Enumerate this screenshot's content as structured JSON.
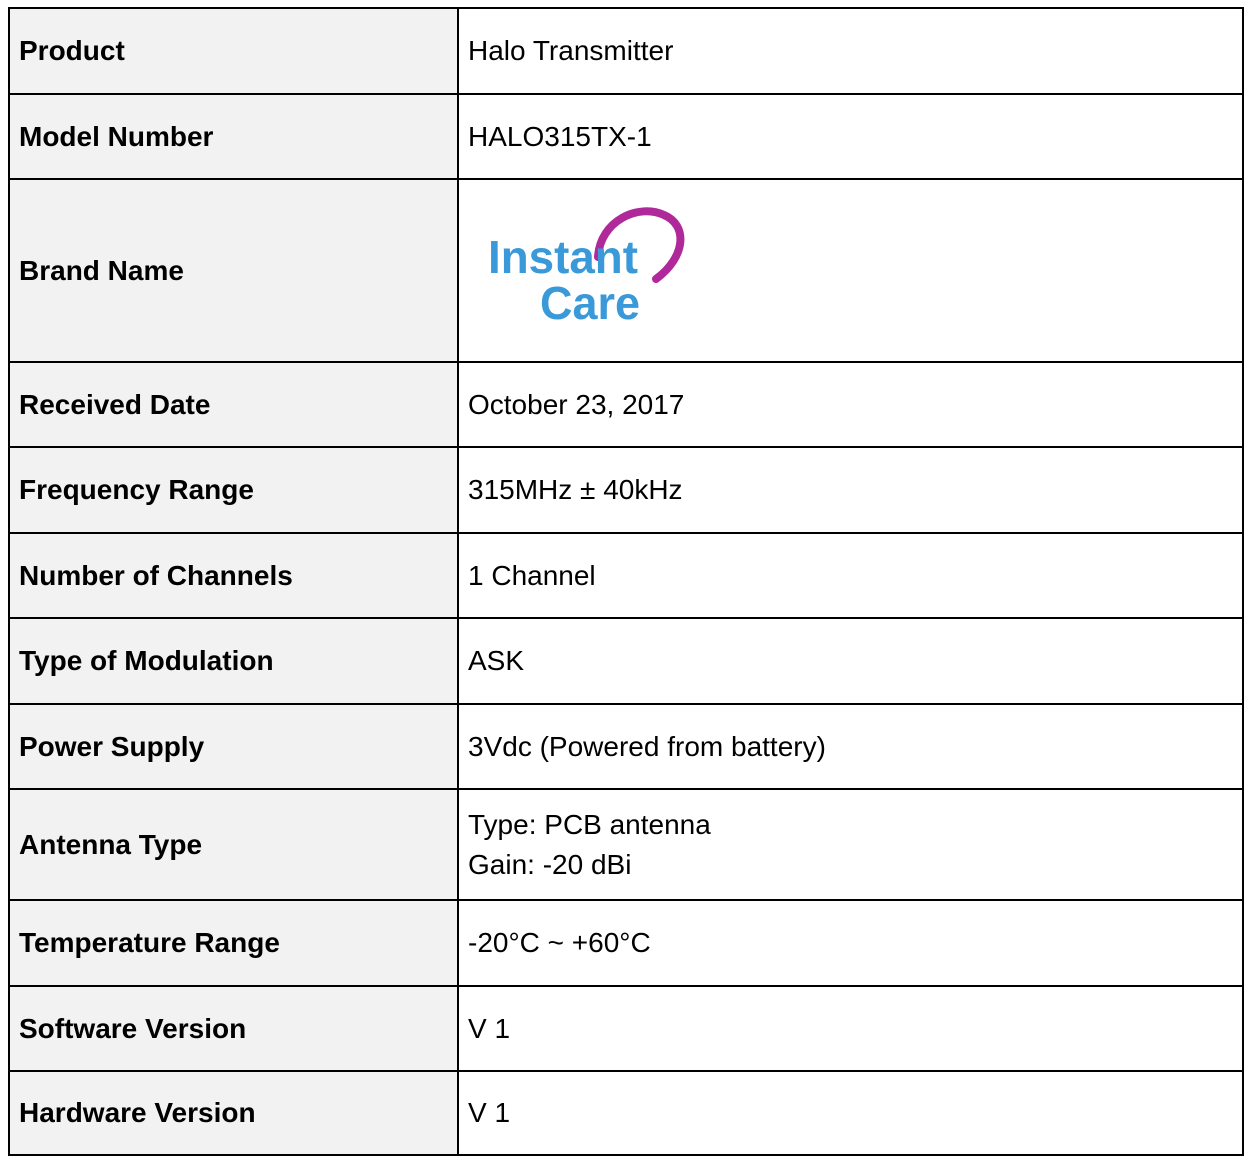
{
  "rows": [
    {
      "label": "Product",
      "value": "Halo Transmitter"
    },
    {
      "label": "Model Number",
      "value": "HALO315TX-1"
    },
    {
      "label": "Brand Name",
      "logo": {
        "line1": "Instant",
        "line2": "Care",
        "text_color": "#3a9ad9",
        "heart_color": "#b0299a"
      }
    },
    {
      "label": "Received Date",
      "value": "October 23, 2017"
    },
    {
      "label": "Frequency Range",
      "value": "315MHz ± 40kHz"
    },
    {
      "label": "Number of Channels",
      "value": "1 Channel"
    },
    {
      "label": "Type of Modulation",
      "value": "ASK"
    },
    {
      "label": "Power Supply",
      "value": "3Vdc (Powered from battery)"
    },
    {
      "label": "Antenna Type",
      "lines": [
        "Type: PCB antenna",
        "Gain: -20 dBi"
      ]
    },
    {
      "label": "Temperature Range",
      "value": "-20°C ~ +60°C"
    },
    {
      "label": "Software Version",
      "value": "V 1"
    },
    {
      "label": "Hardware Version",
      "value": "V 1"
    }
  ]
}
